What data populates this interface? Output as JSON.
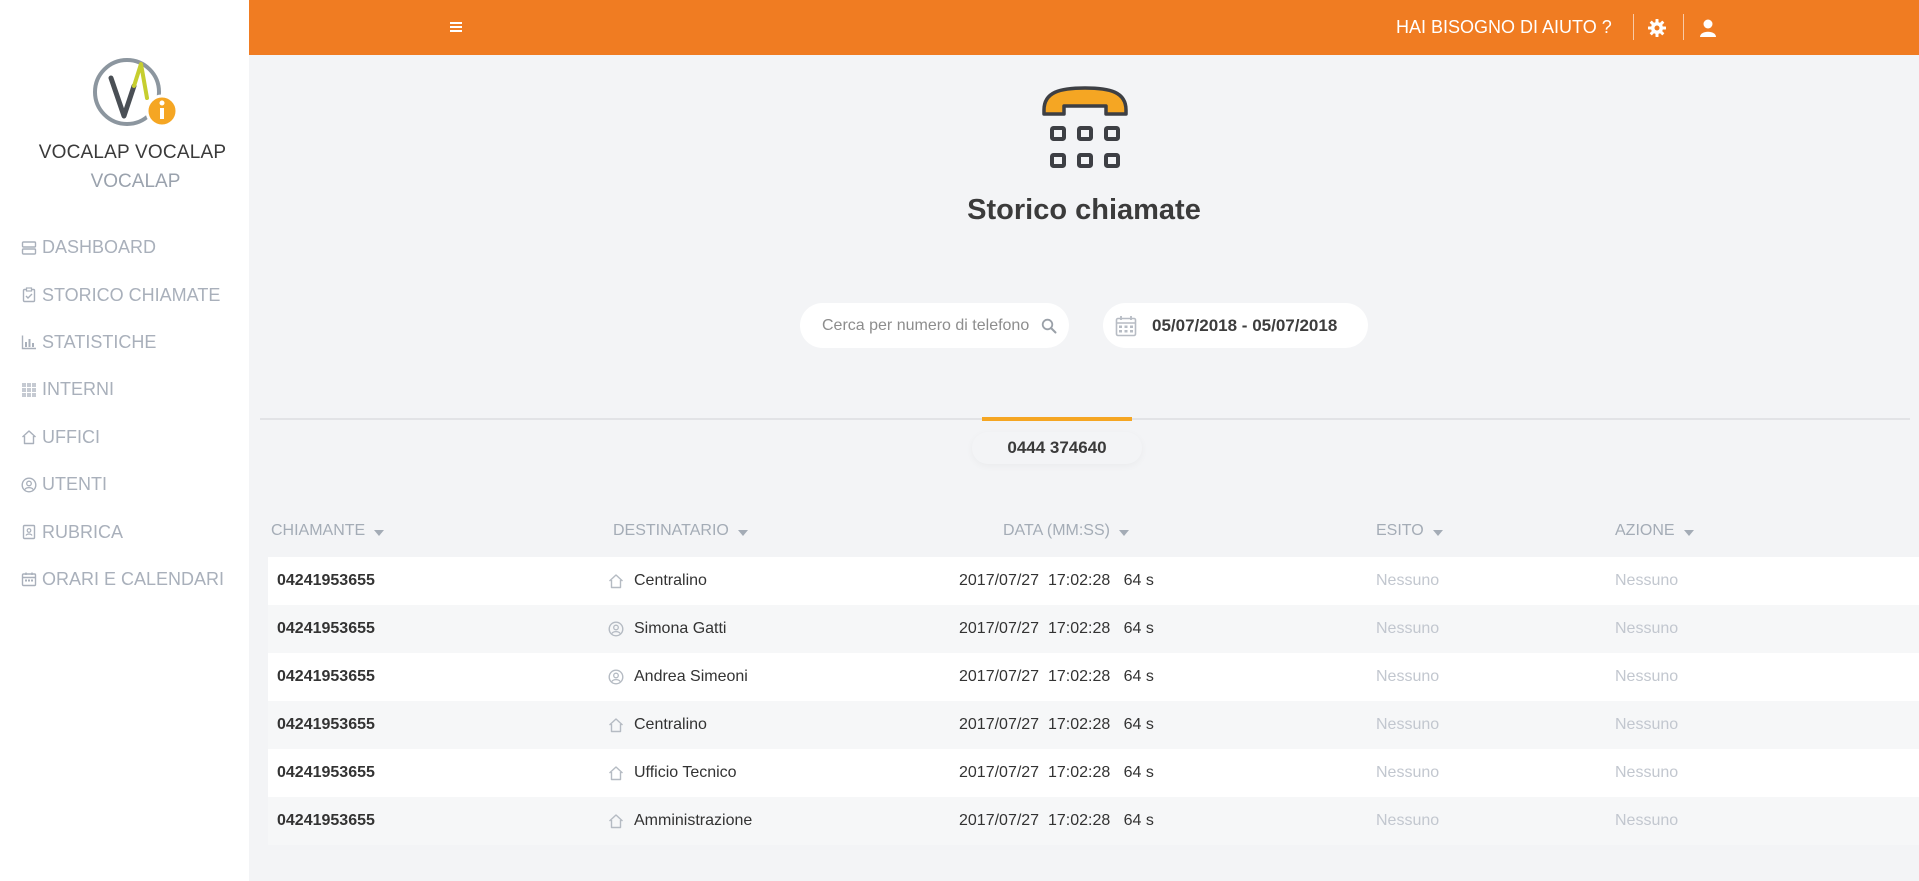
{
  "user": {
    "name": "VOCALAP VOCALAP",
    "subtitle": "VOCALAP"
  },
  "sidebar": {
    "items": [
      {
        "label": "DASHBOARD",
        "icon": "dashboard-icon"
      },
      {
        "label": "STORICO CHIAMATE",
        "icon": "clipboard-icon"
      },
      {
        "label": "STATISTICHE",
        "icon": "bar-chart-icon"
      },
      {
        "label": "INTERNI",
        "icon": "grid-icon"
      },
      {
        "label": "UFFICI",
        "icon": "home-icon"
      },
      {
        "label": "UTENTI",
        "icon": "user-circle-icon"
      },
      {
        "label": "RUBRICA",
        "icon": "address-book-icon"
      },
      {
        "label": "ORARI E CALENDARI",
        "icon": "calendar-icon"
      }
    ]
  },
  "topbar": {
    "help": "HAI BISOGNO DI AIUTO ?",
    "menu_icon": "hamburger-icon",
    "settings_icon": "gear-icon",
    "user_icon": "user-icon"
  },
  "header": {
    "title": "Storico chiamate",
    "icon": "telephone-icon"
  },
  "search": {
    "placeholder": "Cerca per numero di telefono",
    "value": ""
  },
  "date_range": {
    "value": "05/07/2018 - 05/07/2018"
  },
  "tabs": [
    {
      "label": "0444 374640",
      "active": true
    }
  ],
  "table": {
    "columns": [
      "CHIAMANTE",
      "DESTINATARIO",
      "DATA (MM:SS)",
      "ESITO",
      "AZIONE"
    ],
    "rows": [
      {
        "caller": "04241953655",
        "recipient": "Centralino",
        "recipient_icon": "home-icon",
        "date": "2017/07/27",
        "time": "17:02:28",
        "duration": "64 s",
        "outcome": "Nessuno",
        "action": "Nessuno"
      },
      {
        "caller": "04241953655",
        "recipient": "Simona Gatti",
        "recipient_icon": "user-circle-icon",
        "date": "2017/07/27",
        "time": "17:02:28",
        "duration": "64 s",
        "outcome": "Nessuno",
        "action": "Nessuno"
      },
      {
        "caller": "04241953655",
        "recipient": "Andrea Simeoni",
        "recipient_icon": "user-circle-icon",
        "date": "2017/07/27",
        "time": "17:02:28",
        "duration": "64 s",
        "outcome": "Nessuno",
        "action": "Nessuno"
      },
      {
        "caller": "04241953655",
        "recipient": "Centralino",
        "recipient_icon": "home-icon",
        "date": "2017/07/27",
        "time": "17:02:28",
        "duration": "64 s",
        "outcome": "Nessuno",
        "action": "Nessuno"
      },
      {
        "caller": "04241953655",
        "recipient": "Ufficio Tecnico",
        "recipient_icon": "home-icon",
        "date": "2017/07/27",
        "time": "17:02:28",
        "duration": "64 s",
        "outcome": "Nessuno",
        "action": "Nessuno"
      },
      {
        "caller": "04241953655",
        "recipient": "Amministrazione",
        "recipient_icon": "home-icon",
        "date": "2017/07/27",
        "time": "17:02:28",
        "duration": "64 s",
        "outcome": "Nessuno",
        "action": "Nessuno"
      }
    ]
  },
  "colors": {
    "accent": "#f07c22",
    "tab_underline": "#f5a623",
    "muted": "#a9b0bb"
  }
}
